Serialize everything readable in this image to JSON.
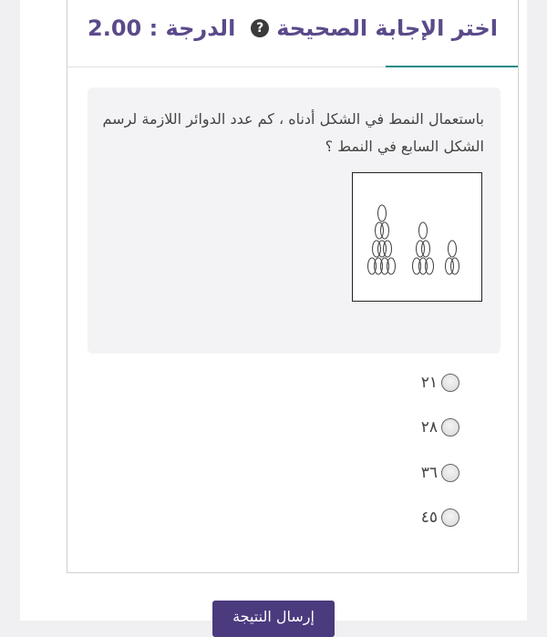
{
  "header": {
    "title": "اختر الإجابة الصحيحة",
    "grade": "الدرجة : 2.00",
    "help_icon": "question-circle-icon"
  },
  "question": {
    "text": "باستعمال النمط في الشكل أدناه ، كم عدد الدوائر اللازمة لرسم الشكل السابع في النمط ؟"
  },
  "options": [
    {
      "label": "٢١",
      "selected": false
    },
    {
      "label": "٢٨",
      "selected": false
    },
    {
      "label": "٣٦",
      "selected": false
    },
    {
      "label": "٤٥",
      "selected": false
    }
  ],
  "submit": {
    "label": "إرسال النتيجة"
  }
}
